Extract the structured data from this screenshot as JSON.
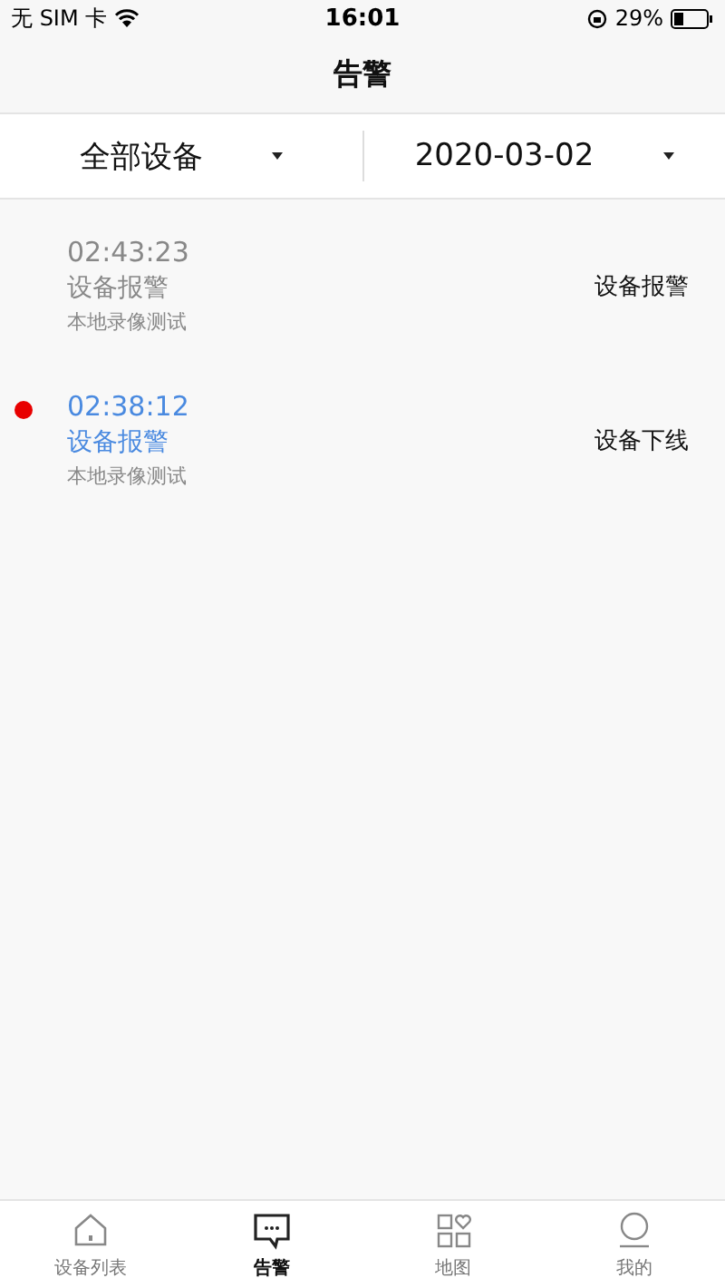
{
  "status_bar": {
    "carrier": "无 SIM 卡",
    "time": "16:01",
    "battery": "29%"
  },
  "title": "告警",
  "filters": [
    {
      "label": "全部设备"
    },
    {
      "label": "2020-03-02"
    }
  ],
  "alerts": [
    {
      "time": "02:43:23",
      "title": "设备报警",
      "source": "本地录像测试",
      "type": "设备报警",
      "unread": false
    },
    {
      "time": "02:38:12",
      "title": "设备报警",
      "source": "本地录像测试",
      "type": "设备下线",
      "unread": true
    }
  ],
  "tabs": [
    {
      "label": "设备列表",
      "kind": "home",
      "selected": false
    },
    {
      "label": "告警",
      "kind": "message",
      "selected": true
    },
    {
      "label": "地图",
      "kind": "grid",
      "selected": false
    },
    {
      "label": "我的",
      "kind": "profile",
      "selected": false
    }
  ]
}
